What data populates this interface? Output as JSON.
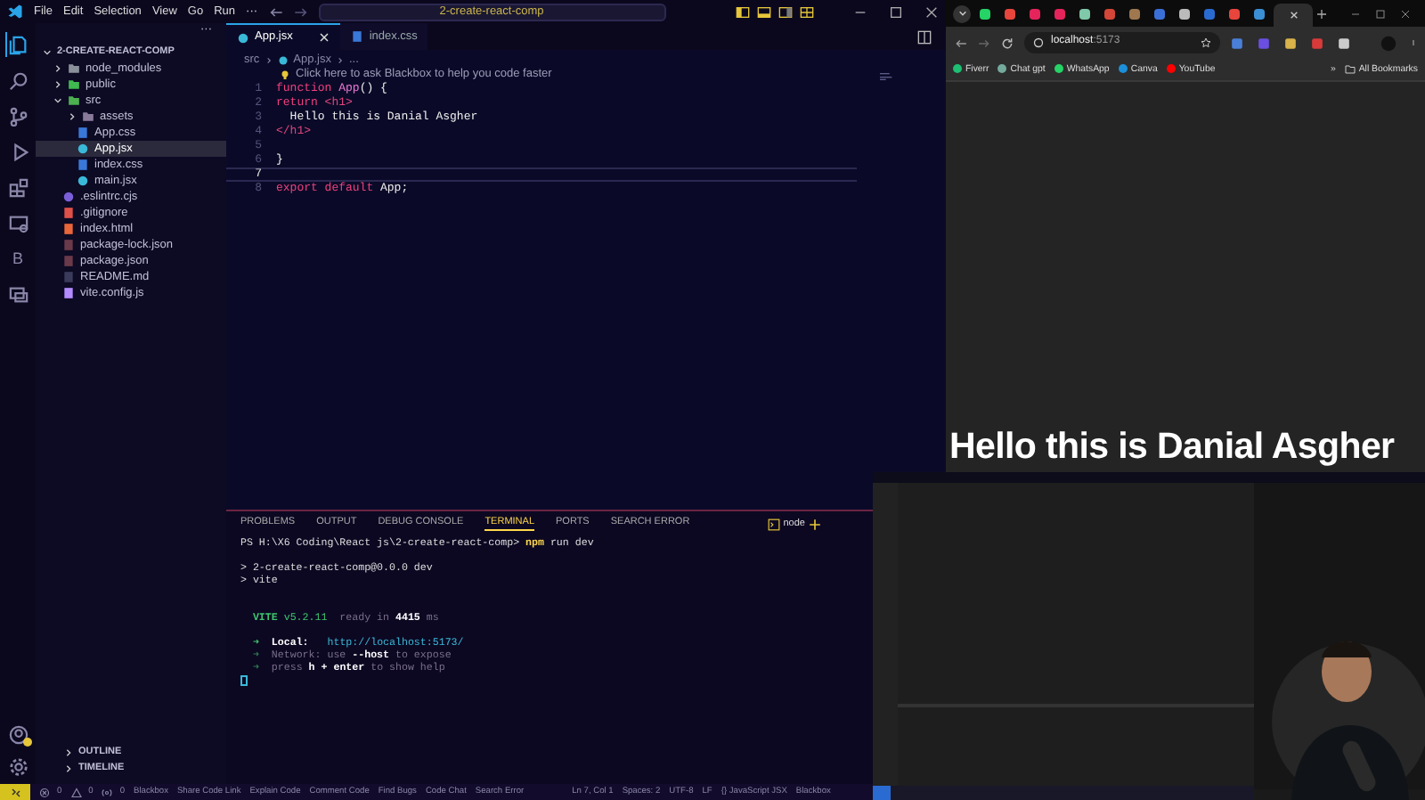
{
  "vscode": {
    "menu": [
      "File",
      "Edit",
      "Selection",
      "View",
      "Go",
      "Run"
    ],
    "menu_more": "···",
    "command_center": "2-create-react-comp",
    "activity": [
      {
        "kind": "explorer",
        "selected": true
      },
      {
        "kind": "search",
        "selected": false
      },
      {
        "kind": "source-control",
        "selected": false
      },
      {
        "kind": "run",
        "selected": false
      },
      {
        "kind": "extensions",
        "selected": false
      },
      {
        "kind": "remote",
        "selected": false
      },
      {
        "kind": "letter",
        "text": "B",
        "selected": false
      },
      {
        "kind": "chat",
        "selected": false
      }
    ],
    "explorer": {
      "more": "···",
      "root": "2-CREATE-REACT-COMP",
      "items": [
        {
          "label": "node_modules",
          "kind": "folder",
          "color": "#8a8f9a",
          "expanded": false,
          "selected": false
        },
        {
          "label": "public",
          "kind": "folder",
          "color": "#3fb950",
          "expanded": false,
          "selected": false
        },
        {
          "label": "src",
          "kind": "folder",
          "color": "#4caf50",
          "expanded": true,
          "selected": false,
          "children": [
            {
              "label": "assets",
              "kind": "folder",
              "color": "#8a7a9a",
              "expanded": false,
              "selected": false
            },
            {
              "label": "App.css",
              "kind": "css",
              "selected": false
            },
            {
              "label": "App.jsx",
              "kind": "react",
              "selected": true
            },
            {
              "label": "index.css",
              "kind": "css",
              "selected": false
            },
            {
              "label": "main.jsx",
              "kind": "react",
              "selected": false
            }
          ]
        },
        {
          "label": ".eslintrc.cjs",
          "kind": "eslint",
          "selected": false
        },
        {
          "label": ".gitignore",
          "kind": "git",
          "selected": false
        },
        {
          "label": "index.html",
          "kind": "html",
          "selected": false
        },
        {
          "label": "package-lock.json",
          "kind": "json",
          "selected": false
        },
        {
          "label": "package.json",
          "kind": "json",
          "selected": false
        },
        {
          "label": "README.md",
          "kind": "markdown",
          "selected": false
        },
        {
          "label": "vite.config.js",
          "kind": "vite",
          "selected": false
        }
      ]
    },
    "sections": [
      "OUTLINE",
      "TIMELINE"
    ],
    "tabs": [
      {
        "label": "App.jsx",
        "kind": "react",
        "selected": true
      },
      {
        "label": "index.css",
        "kind": "css",
        "selected": false
      }
    ],
    "breadcrumb": [
      "src",
      "App.jsx",
      "..."
    ],
    "hint": "Click here to ask Blackbox to help you code faster",
    "lines": [
      {
        "number": "1",
        "current": false,
        "tokens": [
          {
            "text": "function",
            "kind": "keyword"
          },
          {
            "text": " App",
            "kind": "function"
          },
          {
            "text": "() {",
            "kind": "plain"
          }
        ]
      },
      {
        "number": "2",
        "current": false,
        "tokens": [
          {
            "text": "return",
            "kind": "keyword"
          },
          {
            "text": " <h1>",
            "kind": "tag"
          }
        ]
      },
      {
        "number": "3",
        "current": false,
        "tokens": [
          {
            "text": "  Hello this is Danial Asgher",
            "kind": "plain"
          }
        ]
      },
      {
        "number": "4",
        "current": false,
        "tokens": [
          {
            "text": "</h1>",
            "kind": "tag"
          }
        ]
      },
      {
        "number": "5",
        "current": false
      },
      {
        "number": "6",
        "current": false,
        "tokens": [
          {
            "text": "}",
            "kind": "plain"
          }
        ]
      },
      {
        "number": "7",
        "current": true
      },
      {
        "number": "8",
        "current": false,
        "tokens": [
          {
            "text": "export default",
            "kind": "keyword"
          },
          {
            "text": " App;",
            "kind": "plain"
          }
        ]
      }
    ],
    "panel_tabs": [
      {
        "label": "PROBLEMS",
        "selected": false
      },
      {
        "label": "OUTPUT",
        "selected": false
      },
      {
        "label": "DEBUG CONSOLE",
        "selected": false
      },
      {
        "label": "TERMINAL",
        "selected": true
      },
      {
        "label": "PORTS",
        "selected": false
      },
      {
        "label": "SEARCH ERROR",
        "selected": false
      }
    ],
    "shell": "node",
    "terminal": [
      {
        "lines": [
          {
            "spans": [
              {
                "text": "PS H:\\X6 Coding\\React js\\2-create-react-comp> ",
                "kind": "plain"
              },
              {
                "text": "npm",
                "kind": "command"
              },
              {
                "text": " run dev",
                "kind": "plain"
              }
            ]
          }
        ]
      },
      {
        "lines": [
          {
            "spans": [
              {
                "text": "> 2-create-react-comp@0.0.0 dev",
                "kind": "plain"
              }
            ]
          },
          {
            "spans": [
              {
                "text": "> vite",
                "kind": "plain"
              }
            ]
          }
        ]
      },
      {
        "lines": [
          {
            "spans": [
              {
                "text": "  VITE",
                "kind": "green-bold"
              },
              {
                "text": " v5.2.11",
                "kind": "green"
              },
              {
                "text": "  ready in ",
                "kind": "dim"
              },
              {
                "text": "4415",
                "kind": "bold"
              },
              {
                "text": " ms",
                "kind": "dim"
              }
            ]
          }
        ]
      },
      {
        "lines": [
          {
            "spans": [
              {
                "text": "  ➜",
                "kind": "green"
              },
              {
                "text": "  Local:",
                "kind": "bold"
              },
              {
                "text": "   http://localhost:5173/",
                "kind": "url"
              }
            ]
          },
          {
            "spans": [
              {
                "text": "  ➜",
                "kind": "dim-green"
              },
              {
                "text": "  Network: use ",
                "kind": "dim"
              },
              {
                "text": "--host",
                "kind": "bold"
              },
              {
                "text": " to expose",
                "kind": "dim"
              }
            ]
          },
          {
            "spans": [
              {
                "text": "  ➜",
                "kind": "dim-green"
              },
              {
                "text": "  press ",
                "kind": "dim"
              },
              {
                "text": "h + enter",
                "kind": "bold"
              },
              {
                "text": " to show help",
                "kind": "dim"
              }
            ]
          }
        ]
      }
    ],
    "status_left": [
      {
        "kind": "errors",
        "text": "0"
      },
      {
        "kind": "warnings",
        "text": "0"
      },
      {
        "kind": "ports",
        "text": "0"
      },
      {
        "text": "Blackbox"
      },
      {
        "text": "Share Code Link"
      },
      {
        "text": "Explain Code"
      },
      {
        "text": "Comment Code"
      },
      {
        "text": "Find Bugs"
      },
      {
        "text": "Code Chat"
      },
      {
        "text": "Search Error"
      }
    ],
    "status_right": [
      {
        "text": "Ln 7, Col 1"
      },
      {
        "text": "Spaces: 2"
      },
      {
        "text": "UTF-8"
      },
      {
        "text": "LF"
      },
      {
        "text": "{} JavaScript JSX"
      },
      {
        "text": "Blackbox"
      }
    ]
  },
  "browser": {
    "tabs": [
      {
        "color": "#25d366",
        "selected": false
      },
      {
        "color": "#e8453c",
        "selected": false
      },
      {
        "color": "#e5245c",
        "selected": false
      },
      {
        "color": "#e5245c",
        "selected": false
      },
      {
        "color": "#7fc8a9",
        "selected": false
      },
      {
        "color": "#d44638",
        "selected": false
      },
      {
        "color": "#a07850",
        "selected": false
      },
      {
        "color": "#3b6fd8",
        "selected": false
      },
      {
        "color": "#bbbbbb",
        "selected": false
      },
      {
        "color": "#2a6bd1",
        "selected": false
      },
      {
        "color": "#e8453c",
        "selected": false
      },
      {
        "color": "#3a8fd5",
        "selected": false
      },
      {
        "selected": true
      }
    ],
    "host": "localhost",
    "port": ":5173",
    "extensions": [
      {
        "color": "#4a7fd8"
      },
      {
        "color": "#6a4fe0"
      },
      {
        "color": "#d8b24a"
      },
      {
        "color": "#d83a3a"
      },
      {
        "color": "#cccccc"
      }
    ],
    "bookmarks": [
      {
        "label": "Fiverr",
        "color": "#1dbf73"
      },
      {
        "label": "Chat gpt",
        "color": "#74aa9c"
      },
      {
        "label": "WhatsApp",
        "color": "#25d366"
      },
      {
        "label": "Canva",
        "color": "#1c8fd8"
      },
      {
        "label": "YouTube",
        "color": "#ff0000"
      }
    ],
    "more_bookmarks": "»",
    "all_bookmarks": "All Bookmarks",
    "heading": "Hello this is Danial Asgher"
  }
}
